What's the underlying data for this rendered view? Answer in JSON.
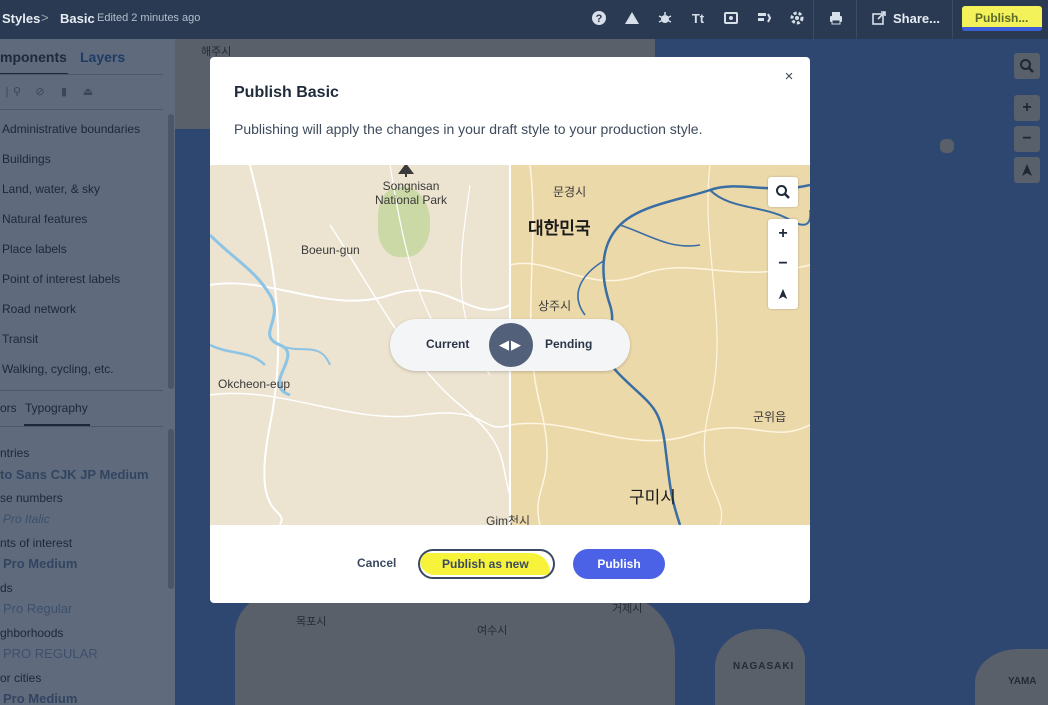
{
  "topbar": {
    "breadcrumb_root": "Styles",
    "breadcrumb_sep": ">",
    "style_name": "Basic",
    "edited": "Edited 2 minutes ago",
    "share_label": "Share...",
    "publish_label": "Publish...",
    "icons": [
      "help-icon",
      "warning-icon",
      "bug-icon",
      "typography-icon",
      "image-icon",
      "layers-icon",
      "settings-icon",
      "print-icon",
      "share-icon"
    ]
  },
  "left_panel": {
    "tab_components": "mponents",
    "tab_layers": "Layers",
    "components": [
      "Administrative boundaries",
      "Buildings",
      "Land, water, & sky",
      "Natural features",
      "Place labels",
      "Point of interest labels",
      "Road network",
      "Transit",
      "Walking, cycling, etc."
    ],
    "sub_tab_colors": "ors",
    "sub_tab_typography": "Typography",
    "typography": [
      {
        "label": "ntries",
        "font": "to Sans CJK JP Medium"
      },
      {
        "label": "se numbers",
        "font": "Pro Italic"
      },
      {
        "label": "nts of interest",
        "font": "Pro Medium"
      },
      {
        "label": "ds",
        "font": "Pro Regular"
      },
      {
        "label": "ghborhoods",
        "font": "PRO REGULAR"
      },
      {
        "label": "or cities",
        "font": "Pro Medium"
      }
    ]
  },
  "background_map": {
    "labels": [
      "해주시",
      "NAGASAKI",
      "YAMA",
      "목포시",
      "여수시",
      "거제시"
    ]
  },
  "modal": {
    "title": "Publish Basic",
    "close": "×",
    "description": "Publishing will apply the changes in your draft style to your production style.",
    "map_labels": {
      "songnisan": "Songnisan\nNational Park",
      "boeun": "Boeun-gun",
      "okcheon": "Okcheon-eup",
      "mungyeong": "문경시",
      "korea": "대한민국",
      "sangju": "상주시",
      "gunwi": "군위읍",
      "gumi": "구미시",
      "gimcheon": "Gim천시"
    },
    "compare_current": "Current",
    "compare_pending": "Pending",
    "compare_handle": "◀▶",
    "cancel_label": "Cancel",
    "publish_new_label": "Publish as new",
    "publish_label": "Publish"
  },
  "colors": {
    "accent": "#4b62e6",
    "highlight": "#f7f33a"
  }
}
